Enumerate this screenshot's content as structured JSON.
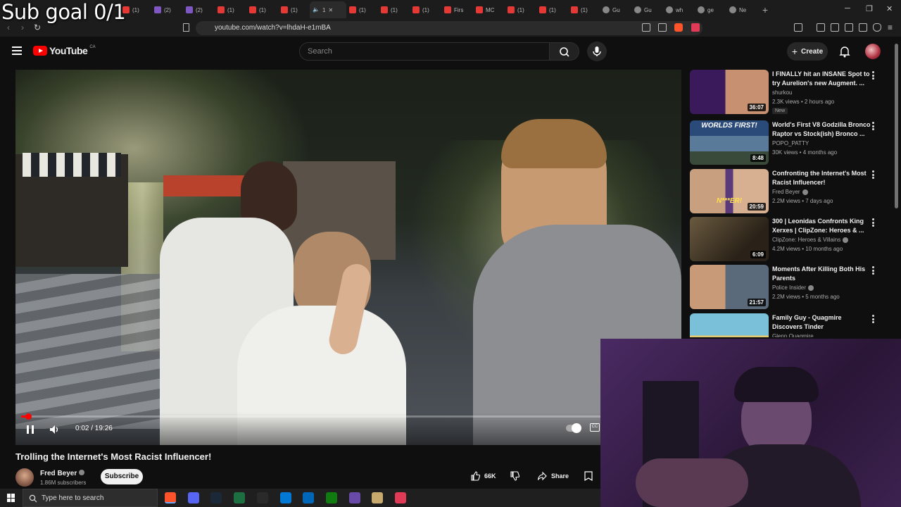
{
  "overlay": {
    "subgoal_text": "Sub goal 0/1"
  },
  "browser": {
    "tabs": [
      {
        "label": "(1)",
        "kind": "youtube"
      },
      {
        "label": "(2)",
        "kind": "purple"
      },
      {
        "label": "(2)",
        "kind": "purple"
      },
      {
        "label": "(1)",
        "kind": "youtube"
      },
      {
        "label": "(1)",
        "kind": "youtube"
      },
      {
        "label": "(1)",
        "kind": "youtube"
      },
      {
        "label": "1",
        "kind": "active"
      },
      {
        "label": "(1)",
        "kind": "youtube"
      },
      {
        "label": "(1)",
        "kind": "youtube"
      },
      {
        "label": "(1)",
        "kind": "youtube"
      },
      {
        "label": "Firs",
        "kind": "youtube"
      },
      {
        "label": "MC",
        "kind": "youtube"
      },
      {
        "label": "(1)",
        "kind": "youtube"
      },
      {
        "label": "(1)",
        "kind": "youtube"
      },
      {
        "label": "(1)",
        "kind": "youtube"
      },
      {
        "label": "Gu",
        "kind": "grey"
      },
      {
        "label": "Gu",
        "kind": "grey"
      },
      {
        "label": "wh",
        "kind": "grey"
      },
      {
        "label": "ge",
        "kind": "grey"
      },
      {
        "label": "Ne",
        "kind": "grey"
      }
    ],
    "new_tab_icon": "plus-icon",
    "url": "youtube.com/watch?v=lhdaH-e1mBA"
  },
  "youtube": {
    "logo_text": "YouTube",
    "region": "CA",
    "search_placeholder": "Search",
    "create_label": "Create",
    "video": {
      "title": "Trolling the Internet's Most Racist Influencer!",
      "time_current": "0:02",
      "time_total": "19:26",
      "time_display": "0:02 / 19:26",
      "progress": 0.0017,
      "channel": "Fred Beyer",
      "subscribers": "1.86M subscribers",
      "subscribe_label": "Subscribe",
      "likes": "66K",
      "share_label": "Share"
    },
    "recommendations": [
      {
        "title": "I FINALLY hit an INSANE Spot to try Aurelion's new Augment. ...",
        "channel": "shurkou",
        "meta": "2.3K views • 2 hours ago",
        "duration": "36:07",
        "badge": "New",
        "verified": false
      },
      {
        "title": "World's First V8 Godzilla Bronco Raptor vs Stock(ish) Bronco ...",
        "channel": "POPO_PATTY",
        "meta": "30K views • 4 months ago",
        "duration": "8:48",
        "verified": false,
        "thumb_text": "WORLDS FIRST!"
      },
      {
        "title": "Confronting the Internet's Most Racist Influencer!",
        "channel": "Fred Beyer",
        "meta": "2.2M views • 7 days ago",
        "duration": "20:59",
        "verified": true,
        "thumb_text": "N***ER!"
      },
      {
        "title": "300 | Leonidas Confronts King Xerxes | ClipZone: Heroes & ...",
        "channel": "ClipZone: Heroes & Villains",
        "meta": "4.2M views • 10 months ago",
        "duration": "6:09",
        "verified": true
      },
      {
        "title": "Moments After Killing Both His Parents",
        "channel": "Police Insider",
        "meta": "2.2M views • 5 months ago",
        "duration": "21:57",
        "verified": true
      },
      {
        "title": "Family Guy - Quagmire Discovers Tinder",
        "channel": "Glenn Quagmire",
        "meta": "",
        "duration": "",
        "verified": false
      }
    ]
  },
  "taskbar": {
    "search_placeholder": "Type here to search",
    "apps": [
      "brave-icon",
      "discord-icon",
      "steam-icon",
      "spreadsheet-icon",
      "epic-games-icon",
      "edge-icon",
      "store-icon",
      "xbox-icon",
      "shield-app-icon",
      "lol-icon",
      "obs-icon"
    ]
  },
  "colors": {
    "yt_red": "#ff0000",
    "bg": "#0f0f0f"
  }
}
